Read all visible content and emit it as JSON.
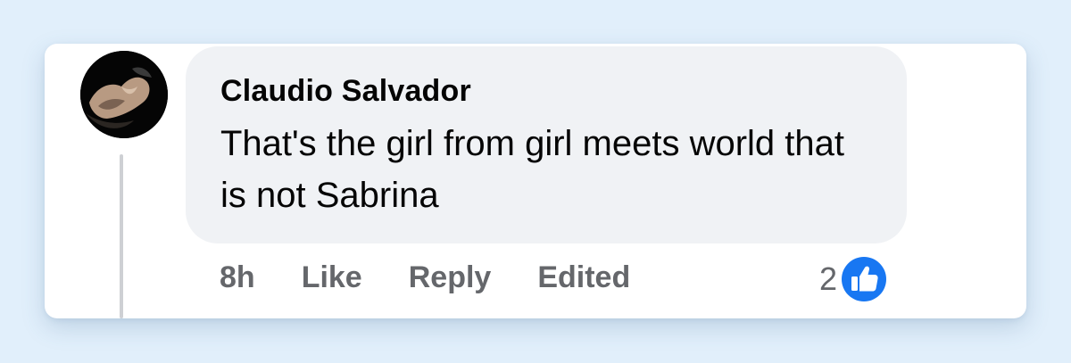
{
  "comment": {
    "author": "Claudio Salvador",
    "text": "That's the girl from girl meets world that is not Sabrina",
    "timestamp": "8h",
    "actions": {
      "like": "Like",
      "reply": "Reply",
      "edited": "Edited"
    },
    "reactions": {
      "count": "2",
      "icon": "thumbs-up-icon",
      "color": "#1877f2"
    }
  },
  "colors": {
    "background": "#e1effb",
    "bubble": "#f0f2f5",
    "meta_text": "#65676b",
    "like_blue": "#1877f2"
  }
}
